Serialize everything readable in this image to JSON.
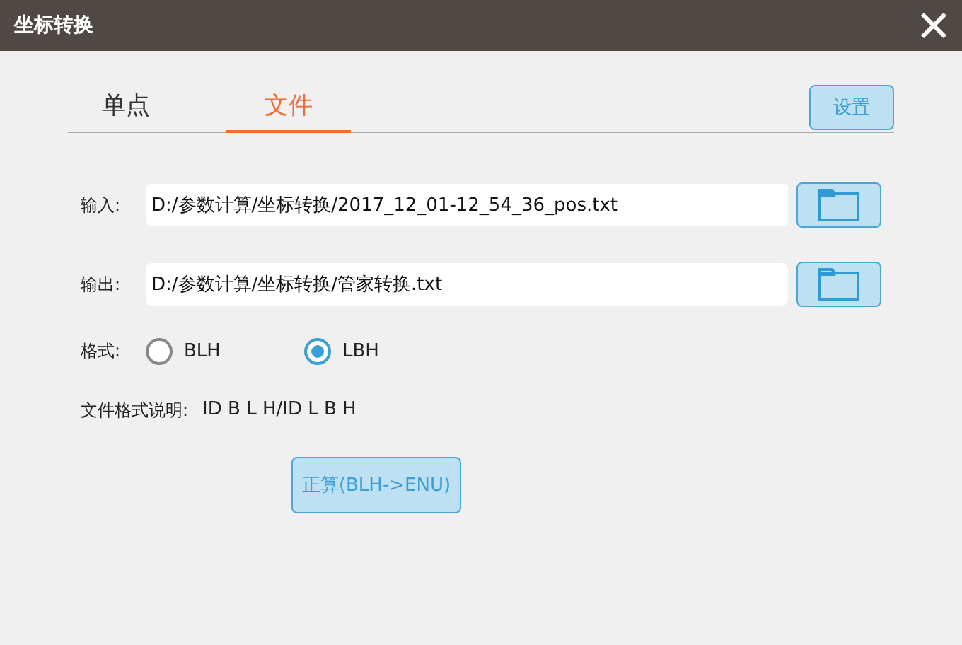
{
  "window": {
    "title": "坐标转换"
  },
  "tabs": [
    {
      "label": "单点",
      "selected": false
    },
    {
      "label": "文件",
      "selected": true
    }
  ],
  "settings_button": "设置",
  "files": [
    {
      "label": "输入:",
      "value": "D:/参数计算/坐标转换/2017_12_01-12_54_36_pos.txt"
    },
    {
      "label": "输出:",
      "value": "D:/参数计算/坐标转换/管家转换.txt"
    }
  ],
  "format": {
    "label": "格式:",
    "options": [
      {
        "label": "BLH",
        "selected": false
      },
      {
        "label": "LBH",
        "selected": true
      }
    ]
  },
  "description": {
    "label": "文件格式说明:",
    "value": "ID B L H/ID L B H"
  },
  "compute_button": "正算(BLH->ENU)"
}
